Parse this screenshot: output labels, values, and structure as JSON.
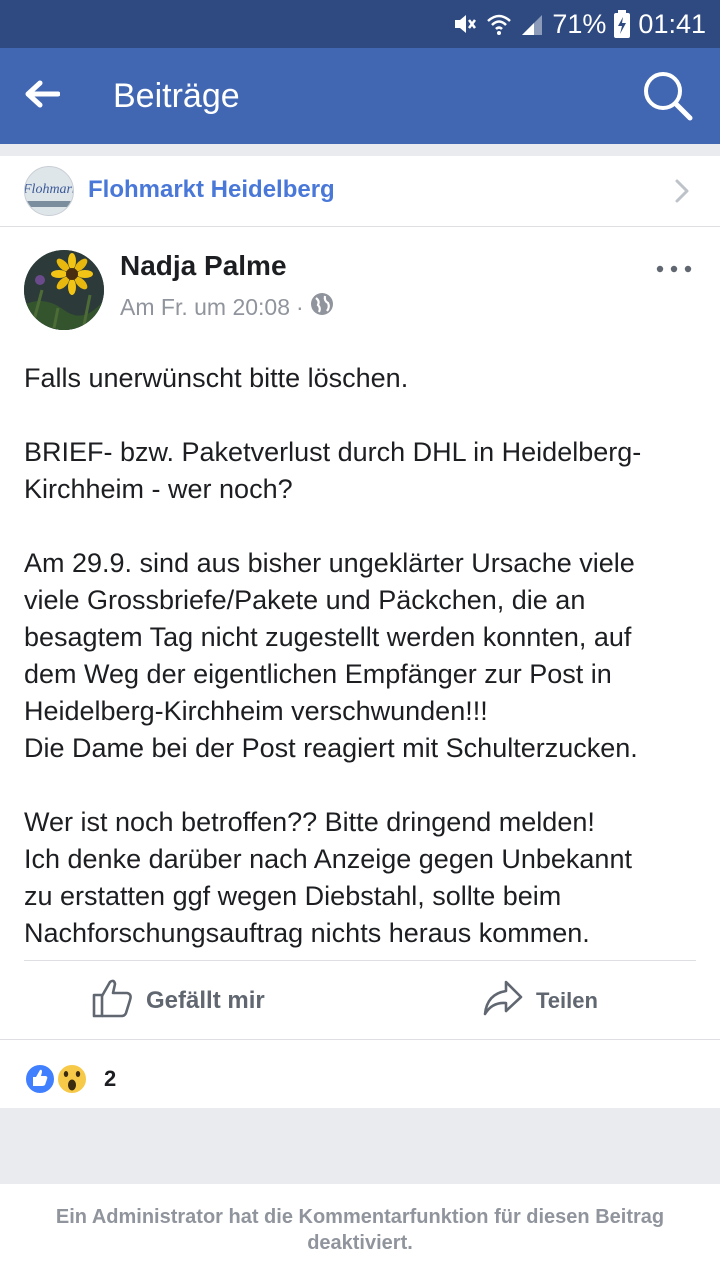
{
  "status_bar": {
    "battery_percent": "71%",
    "time": "01:41",
    "icons": [
      "mute-icon",
      "wifi-icon",
      "signal-icon",
      "battery-charging-icon"
    ]
  },
  "app_bar": {
    "title": "Beiträge",
    "back_icon": "arrow-left-icon",
    "search_icon": "search-icon"
  },
  "group": {
    "avatar_text": "Flohmarkt",
    "name": "Flohmarkt Heidelberg",
    "chevron_icon": "chevron-right-icon"
  },
  "post": {
    "author": "Nadja Palme",
    "timestamp": "Am Fr. um 20:08",
    "separator": "·",
    "privacy_icon": "globe-icon",
    "more_icon": "more-dots-icon",
    "body": "Falls unerwünscht bitte löschen.\n\nBRIEF- bzw. Paketverlust durch DHL in Heidelberg-\nKirchheim - wer noch?\n\nAm 29.9. sind aus bisher ungeklärter Ursache viele\nviele Grossbriefe/Pakete und Päckchen, die an\nbesagtem Tag nicht zugestellt werden konnten, auf\ndem Weg der eigentlichen Empfänger zur Post in\nHeidelberg-Kirchheim verschwunden!!!\nDie Dame bei der Post reagiert mit Schulterzucken.\n\nWer ist noch betroffen?? Bitte dringend melden!\nIch denke darüber nach Anzeige gegen Unbekannt\nzu erstatten ggf wegen Diebstahl, sollte beim\nNachforschungsauftrag nichts heraus kommen."
  },
  "actions": {
    "like_label": "Gefällt mir",
    "share_label": "Teilen"
  },
  "reactions": {
    "count": "2",
    "types": [
      "like-reaction-icon",
      "wow-reaction-icon"
    ]
  },
  "footer": {
    "comments_disabled": "Ein Administrator hat die Kommentarfunktion für diesen Beitrag deaktiviert."
  },
  "colors": {
    "status_bar": "#2f4a80",
    "app_bar": "#4267b2",
    "group_link": "#4a78d8",
    "meta_text": "#90949c",
    "like_blue": "#4080ff",
    "wow_yellow": "#f7c948"
  }
}
